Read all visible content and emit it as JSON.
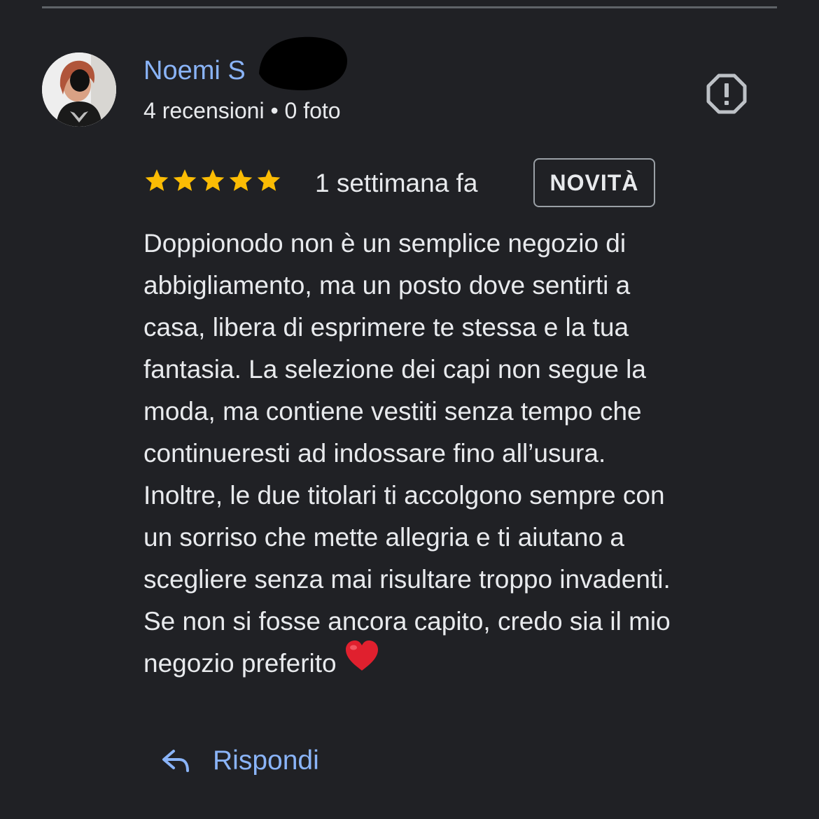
{
  "reviewer": {
    "name": "Noemi S",
    "meta": "4 recensioni • 0 foto"
  },
  "review": {
    "rating": 5,
    "rating_max": 5,
    "time_ago": "1 settimana fa",
    "badge": "NOVITÀ",
    "lines": [
      "Doppionodo non è un semplice negozio di",
      "abbigliamento, ma un posto dove sentirti a",
      "casa, libera di esprimere te stessa e la tua",
      "fantasia. La selezione dei capi non segue la",
      "moda, ma contiene vestiti senza tempo che",
      "continueresti ad indossare fino all’usura.",
      "Inoltre, le due titolari ti accolgono sempre con",
      "un sorriso che mette allegria e ti aiutano a",
      "scegliere senza mai risultare troppo invadenti.",
      "Se non si fosse ancora capito, credo sia il mio",
      "negozio preferito"
    ]
  },
  "actions": {
    "reply_label": "Rispondi"
  },
  "icons": {
    "report": "report-flag-icon",
    "reply": "reply-arrow-icon",
    "star": "star-icon",
    "heart": "red-heart-emoji"
  },
  "colors": {
    "background": "#202125",
    "link": "#8ab4f8",
    "text": "#e8eaed",
    "star": "#fbbc04",
    "heart": "#e0202e"
  }
}
